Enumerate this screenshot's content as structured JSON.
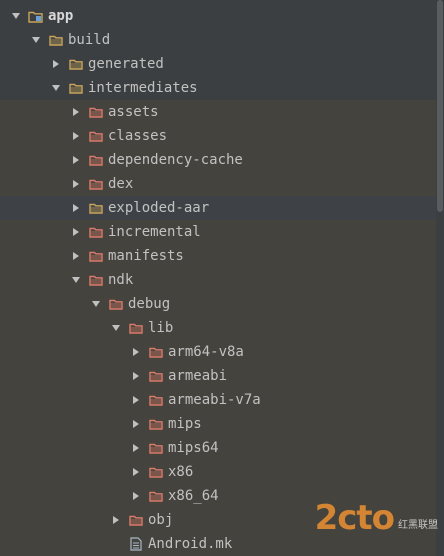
{
  "tree": [
    {
      "label": "app",
      "depth": 0,
      "expanded": true,
      "icon": "module-folder-icon",
      "style": "bold"
    },
    {
      "label": "build",
      "depth": 1,
      "expanded": true,
      "icon": "folder-icon",
      "style": "normal"
    },
    {
      "label": "generated",
      "depth": 2,
      "expanded": false,
      "icon": "folder-icon",
      "style": "normal"
    },
    {
      "label": "intermediates",
      "depth": 2,
      "expanded": true,
      "icon": "folder-icon",
      "style": "normal"
    },
    {
      "label": "assets",
      "depth": 3,
      "expanded": false,
      "icon": "excluded-folder-icon",
      "style": "excluded"
    },
    {
      "label": "classes",
      "depth": 3,
      "expanded": false,
      "icon": "excluded-folder-icon",
      "style": "excluded"
    },
    {
      "label": "dependency-cache",
      "depth": 3,
      "expanded": false,
      "icon": "excluded-folder-icon",
      "style": "excluded"
    },
    {
      "label": "dex",
      "depth": 3,
      "expanded": false,
      "icon": "excluded-folder-icon",
      "style": "excluded"
    },
    {
      "label": "exploded-aar",
      "depth": 3,
      "expanded": false,
      "icon": "folder-icon",
      "style": "selected"
    },
    {
      "label": "incremental",
      "depth": 3,
      "expanded": false,
      "icon": "excluded-folder-icon",
      "style": "excluded"
    },
    {
      "label": "manifests",
      "depth": 3,
      "expanded": false,
      "icon": "excluded-folder-icon",
      "style": "excluded"
    },
    {
      "label": "ndk",
      "depth": 3,
      "expanded": true,
      "icon": "excluded-folder-icon",
      "style": "excluded"
    },
    {
      "label": "debug",
      "depth": 4,
      "expanded": true,
      "icon": "excluded-folder-icon",
      "style": "excluded"
    },
    {
      "label": "lib",
      "depth": 5,
      "expanded": true,
      "icon": "excluded-folder-icon",
      "style": "excluded"
    },
    {
      "label": "arm64-v8a",
      "depth": 6,
      "expanded": false,
      "icon": "excluded-folder-icon",
      "style": "excluded"
    },
    {
      "label": "armeabi",
      "depth": 6,
      "expanded": false,
      "icon": "excluded-folder-icon",
      "style": "excluded"
    },
    {
      "label": "armeabi-v7a",
      "depth": 6,
      "expanded": false,
      "icon": "excluded-folder-icon",
      "style": "excluded"
    },
    {
      "label": "mips",
      "depth": 6,
      "expanded": false,
      "icon": "excluded-folder-icon",
      "style": "excluded"
    },
    {
      "label": "mips64",
      "depth": 6,
      "expanded": false,
      "icon": "excluded-folder-icon",
      "style": "excluded"
    },
    {
      "label": "x86",
      "depth": 6,
      "expanded": false,
      "icon": "excluded-folder-icon",
      "style": "excluded"
    },
    {
      "label": "x86_64",
      "depth": 6,
      "expanded": false,
      "icon": "excluded-folder-icon",
      "style": "excluded"
    },
    {
      "label": "obj",
      "depth": 5,
      "expanded": false,
      "icon": "excluded-folder-icon",
      "style": "excluded"
    },
    {
      "label": "Android.mk",
      "depth": 5,
      "expanded": null,
      "icon": "file-icon",
      "style": "excluded"
    }
  ],
  "colors": {
    "panel_bg": "#3c3f41",
    "excluded_row_bg": "#45433d",
    "selected_row_bg": "#3e4246",
    "folder_yellow": "#c9a45b",
    "folder_excluded": "#d97a6b",
    "text": "#bbbbbb"
  },
  "watermark": {
    "logo": "2cto",
    "sub": "红黑联盟"
  }
}
